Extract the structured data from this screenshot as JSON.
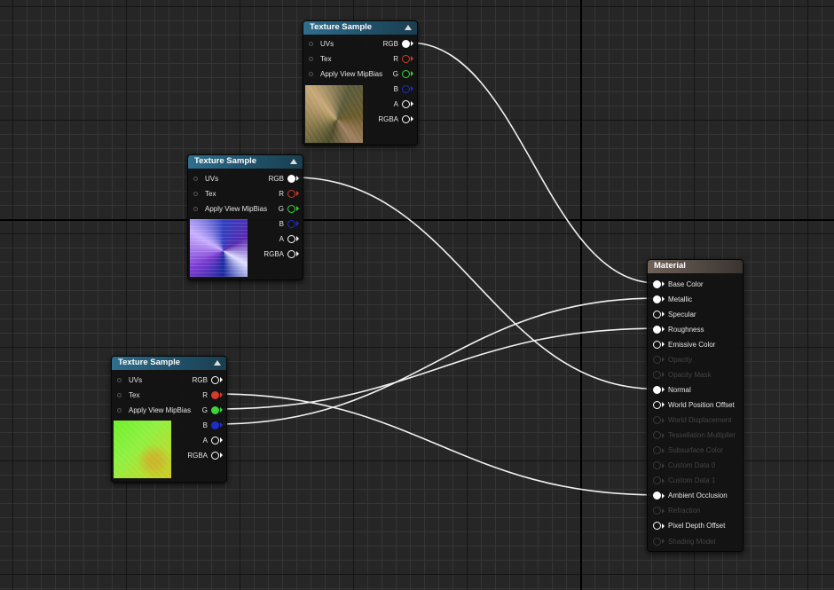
{
  "texture_nodes": [
    {
      "title": "Texture Sample",
      "inputs": [
        "UVs",
        "Tex",
        "Apply View MipBias"
      ],
      "outputs": [
        {
          "label": "RGB",
          "color": "#ffffff",
          "connected": true
        },
        {
          "label": "R",
          "color": "#d63a2a",
          "connected": false
        },
        {
          "label": "G",
          "color": "#3cd43c",
          "connected": false
        },
        {
          "label": "B",
          "color": "#1f2dc8",
          "connected": false
        },
        {
          "label": "A",
          "color": "#ffffff",
          "connected": false
        },
        {
          "label": "RGBA",
          "color": "#ffffff",
          "connected": false
        }
      ]
    },
    {
      "title": "Texture Sample",
      "inputs": [
        "UVs",
        "Tex",
        "Apply View MipBias"
      ],
      "outputs": [
        {
          "label": "RGB",
          "color": "#ffffff",
          "connected": true
        },
        {
          "label": "R",
          "color": "#d63a2a",
          "connected": false
        },
        {
          "label": "G",
          "color": "#3cd43c",
          "connected": false
        },
        {
          "label": "B",
          "color": "#1f2dc8",
          "connected": false
        },
        {
          "label": "A",
          "color": "#ffffff",
          "connected": false
        },
        {
          "label": "RGBA",
          "color": "#ffffff",
          "connected": false
        }
      ]
    },
    {
      "title": "Texture Sample",
      "inputs": [
        "UVs",
        "Tex",
        "Apply View MipBias"
      ],
      "outputs": [
        {
          "label": "RGB",
          "color": "#ffffff",
          "connected": false
        },
        {
          "label": "R",
          "color": "#d63a2a",
          "connected": true
        },
        {
          "label": "G",
          "color": "#3cd43c",
          "connected": true
        },
        {
          "label": "B",
          "color": "#1f2dc8",
          "connected": true
        },
        {
          "label": "A",
          "color": "#ffffff",
          "connected": false
        },
        {
          "label": "RGBA",
          "color": "#ffffff",
          "connected": false
        }
      ]
    }
  ],
  "material_node": {
    "title": "Material",
    "inputs": [
      {
        "label": "Base Color",
        "enabled": true,
        "connected": true
      },
      {
        "label": "Metallic",
        "enabled": true,
        "connected": true
      },
      {
        "label": "Specular",
        "enabled": true,
        "connected": false
      },
      {
        "label": "Roughness",
        "enabled": true,
        "connected": true
      },
      {
        "label": "Emissive Color",
        "enabled": true,
        "connected": false
      },
      {
        "label": "Opacity",
        "enabled": false,
        "connected": false
      },
      {
        "label": "Opacity Mask",
        "enabled": false,
        "connected": false
      },
      {
        "label": "Normal",
        "enabled": true,
        "connected": true
      },
      {
        "label": "World Position Offset",
        "enabled": true,
        "connected": false
      },
      {
        "label": "World Displacement",
        "enabled": false,
        "connected": false
      },
      {
        "label": "Tessellation Multiplier",
        "enabled": false,
        "connected": false
      },
      {
        "label": "Subsurface Color",
        "enabled": false,
        "connected": false
      },
      {
        "label": "Custom Data 0",
        "enabled": false,
        "connected": false
      },
      {
        "label": "Custom Data 1",
        "enabled": false,
        "connected": false
      },
      {
        "label": "Ambient Occlusion",
        "enabled": true,
        "connected": true
      },
      {
        "label": "Refraction",
        "enabled": false,
        "connected": false
      },
      {
        "label": "Pixel Depth Offset",
        "enabled": true,
        "connected": false
      },
      {
        "label": "Shading Model",
        "enabled": false,
        "connected": false
      }
    ]
  },
  "connections": [
    {
      "from_node": 0,
      "from_pin": "RGB",
      "to_pin": "Base Color"
    },
    {
      "from_node": 1,
      "from_pin": "RGB",
      "to_pin": "Normal"
    },
    {
      "from_node": 2,
      "from_pin": "R",
      "to_pin": "Ambient Occlusion"
    },
    {
      "from_node": 2,
      "from_pin": "G",
      "to_pin": "Roughness"
    },
    {
      "from_node": 2,
      "from_pin": "B",
      "to_pin": "Metallic"
    }
  ],
  "colors": {
    "canvas": "#262626",
    "wire": "#f2f2f2",
    "texture_header": "#2e6e8e",
    "material_header": "#6e6259"
  }
}
